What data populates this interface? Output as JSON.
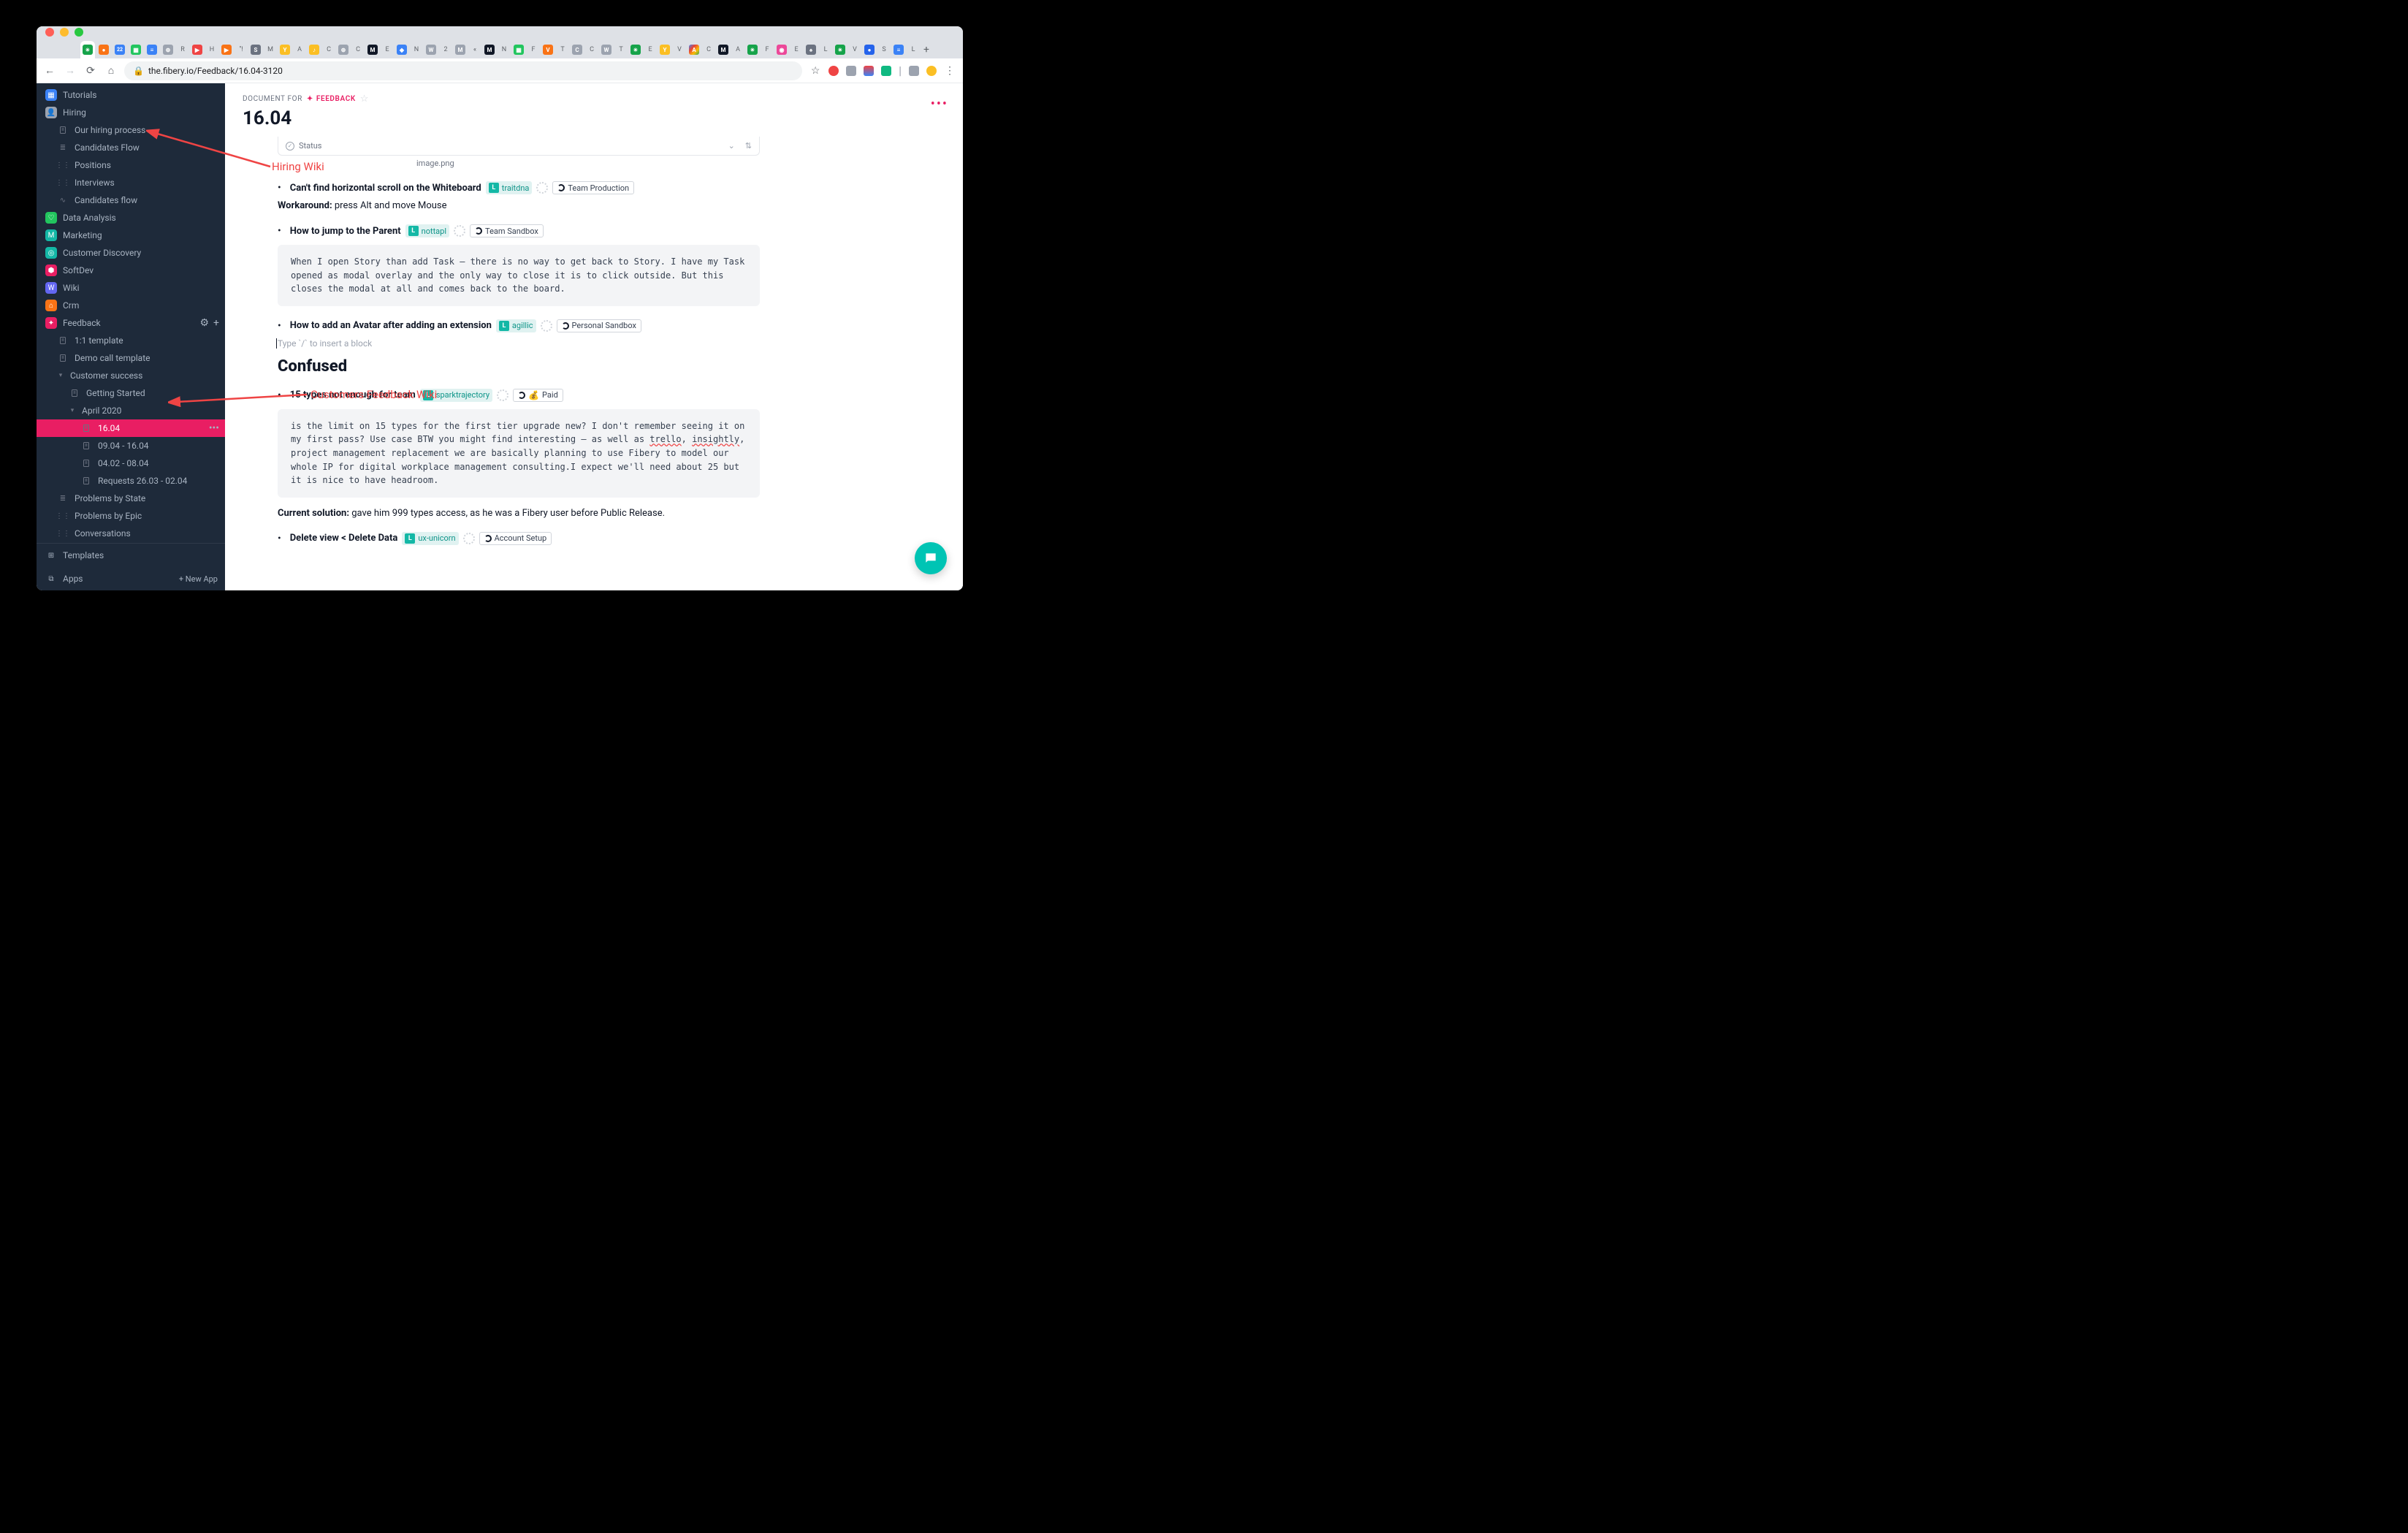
{
  "browser": {
    "url": "the.fibery.io/Feedback/16.04-3120"
  },
  "crumb": {
    "prefix": "DOCUMENT FOR",
    "entity": "FEEDBACK"
  },
  "title": "16.04",
  "status_label": "Status",
  "image_label": "image.png",
  "sidebar": {
    "spaces": [
      {
        "label": "Tutorials",
        "icon_bg": "#3b82f6",
        "glyph": "▦"
      },
      {
        "label": "Hiring",
        "icon_bg": "#9ca3af",
        "glyph": "👤",
        "children": [
          {
            "label": "Our hiring process",
            "glyph": "📄"
          },
          {
            "label": "Candidates Flow",
            "glyph": "≣"
          },
          {
            "label": "Positions",
            "glyph": "⋮⋮"
          },
          {
            "label": "Interviews",
            "glyph": "⋮⋮"
          },
          {
            "label": "Candidates flow",
            "glyph": "∿"
          }
        ]
      },
      {
        "label": "Data Analysis",
        "icon_bg": "#22c55e",
        "glyph": "♡"
      },
      {
        "label": "Marketing",
        "icon_bg": "#14b8a6",
        "glyph": "M"
      },
      {
        "label": "Customer Discovery",
        "icon_bg": "#14b8a6",
        "glyph": "◎"
      },
      {
        "label": "SoftDev",
        "icon_bg": "#e91e63",
        "glyph": "⬢"
      },
      {
        "label": "Wiki",
        "icon_bg": "#6366f1",
        "glyph": "W"
      },
      {
        "label": "Crm",
        "icon_bg": "#f97316",
        "glyph": "⌂"
      },
      {
        "label": "Feedback",
        "icon_bg": "#e91e63",
        "glyph": "✦",
        "actions": true,
        "children": [
          {
            "label": "1:1 template",
            "glyph": "📄"
          },
          {
            "label": "Demo call template",
            "glyph": "📄"
          },
          {
            "label": "Customer success",
            "glyph": "▾",
            "children": [
              {
                "label": "Getting Started",
                "glyph": "📄"
              },
              {
                "label": "April 2020",
                "glyph": "▾",
                "children": [
                  {
                    "label": "16.04",
                    "glyph": "📄",
                    "active": true
                  },
                  {
                    "label": "09.04 - 16.04",
                    "glyph": "📄"
                  },
                  {
                    "label": "04.02 - 08.04",
                    "glyph": "📄"
                  },
                  {
                    "label": "Requests 26.03 - 02.04",
                    "glyph": "📄"
                  }
                ]
              }
            ]
          },
          {
            "label": "Problems by State",
            "glyph": "≣"
          },
          {
            "label": "Problems by Epic",
            "glyph": "⋮⋮"
          },
          {
            "label": "Conversations",
            "glyph": "⋮⋮"
          }
        ]
      }
    ],
    "bottom": {
      "templates": "Templates",
      "apps": "Apps",
      "new_app": "+ New App"
    }
  },
  "items": [
    {
      "title": "Can't find horizontal scroll on the Whiteboard",
      "company": "traitdna",
      "tag": "Team Production"
    }
  ],
  "workaround": {
    "label": "Workaround:",
    "text": " press Alt and move Mouse"
  },
  "items2": [
    {
      "title": "How to jump to the Parent",
      "company": "nottapl",
      "tag": "Team Sandbox"
    }
  ],
  "code1": "When I open Story than add Task — there is no way to get back to Story. I have my Task opened as modal overlay and the only way to close it is to click outside. But this closes the modal at all and comes back to the board.",
  "items3": [
    {
      "title": "How to add an Avatar after adding an extension",
      "company": "agillic",
      "tag": "Personal Sandbox"
    }
  ],
  "placeholder": "Type `/` to insert a block",
  "section2": "Confused",
  "items4": [
    {
      "title": "15 types not enough for team",
      "company": "sparktrajectory",
      "money": "💰",
      "paid": "Paid"
    }
  ],
  "code2_parts": {
    "p1": "is the limit on 15 types for the first tier upgrade new? I don't remember seeing it on my first pass? Use case BTW you might find interesting — as well as ",
    "w1": "trello",
    "p2": ", ",
    "w2": "insightly",
    "p3": ", project management replacement we are basically planning to use Fibery to model our whole IP for digital workplace management consulting.I expect we'll need about 25 but it is nice to have headroom."
  },
  "current_solution": {
    "label": "Current solution:",
    "text": " gave him 999 types access, as he was a Fibery user before Public Release."
  },
  "items5": [
    {
      "title": "Delete view < Delete Data",
      "company": "ux-unicorn",
      "tag": "Account Setup"
    }
  ],
  "annotations": {
    "a1": "Hiring Wiki",
    "a2": "Customers Feedback Wiki"
  }
}
